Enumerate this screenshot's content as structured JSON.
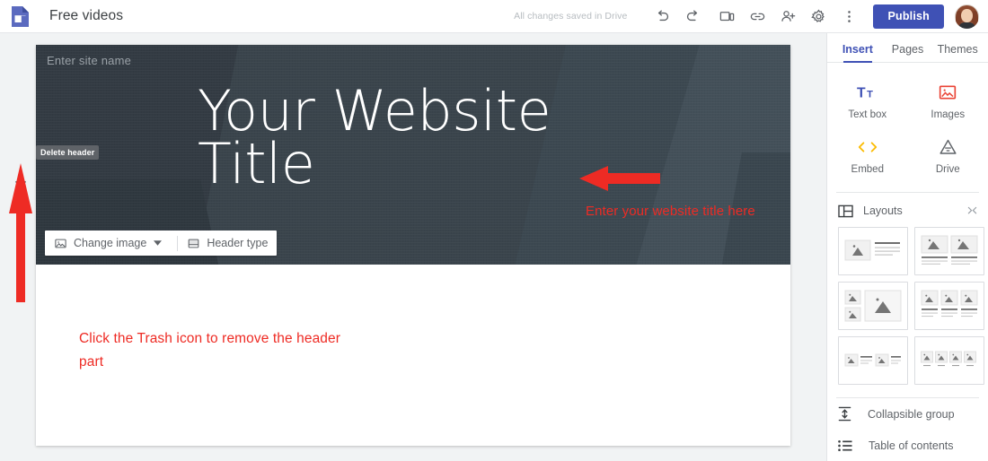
{
  "topbar": {
    "logo_icon": "google-sites-logo",
    "doc_title": "Free videos",
    "save_state": "All changes saved in Drive",
    "tools": [
      {
        "name": "undo-icon",
        "label": "Undo"
      },
      {
        "name": "redo-icon",
        "label": "Redo"
      },
      {
        "name": "preview-icon",
        "label": "Preview"
      },
      {
        "name": "link-icon",
        "label": "Copy site link"
      },
      {
        "name": "add-person-icon",
        "label": "Share with others"
      },
      {
        "name": "gear-icon",
        "label": "Settings"
      },
      {
        "name": "more-vert-icon",
        "label": "More"
      }
    ],
    "publish_label": "Publish",
    "avatar_name": "user-avatar"
  },
  "gutter": {
    "trash_icon": "trash-icon",
    "tooltip": "Delete header"
  },
  "canvas": {
    "site_name_placeholder": "Enter site name",
    "hero_title": "Your Website Title",
    "hero_buttons": [
      {
        "name": "change-image-button",
        "label": "Change image",
        "icon": "image-icon",
        "caret": true
      },
      {
        "name": "header-type-button",
        "label": "Header type",
        "icon": "header-type-icon",
        "caret": false
      }
    ]
  },
  "annotations": {
    "arrow_color": "#ee2b24",
    "title_note": "Enter your website title here",
    "trash_note": "Click the Trash icon to remove the header part"
  },
  "panel": {
    "tabs": [
      {
        "label": "Insert",
        "active": true
      },
      {
        "label": "Pages",
        "active": false
      },
      {
        "label": "Themes",
        "active": false
      }
    ],
    "accent_color": "#3f51b5",
    "insert_items": [
      {
        "label": "Text box",
        "icon": "text-box-icon",
        "color": "#3f51b5"
      },
      {
        "label": "Images",
        "icon": "images-icon",
        "color": "#ea4335"
      },
      {
        "label": "Embed",
        "icon": "embed-code-icon",
        "color": "#fbbc04"
      },
      {
        "label": "Drive",
        "icon": "drive-icon",
        "color": "#5f6368"
      }
    ],
    "layouts": {
      "title": "Layouts",
      "icon": "layouts-icon",
      "collapse_icon": "collapse-icon",
      "thumbs": [
        {
          "name": "layout-image-left-text-right"
        },
        {
          "name": "layout-two-images-with-text"
        },
        {
          "name": "layout-two-small-one-large-image"
        },
        {
          "name": "layout-three-images-with-text"
        },
        {
          "name": "layout-two-image-text-pairs"
        },
        {
          "name": "layout-four-images-with-captions"
        }
      ]
    },
    "bottom_items": [
      {
        "label": "Collapsible group",
        "icon": "collapsible-group-icon"
      },
      {
        "label": "Table of contents",
        "icon": "table-of-contents-icon"
      }
    ]
  }
}
